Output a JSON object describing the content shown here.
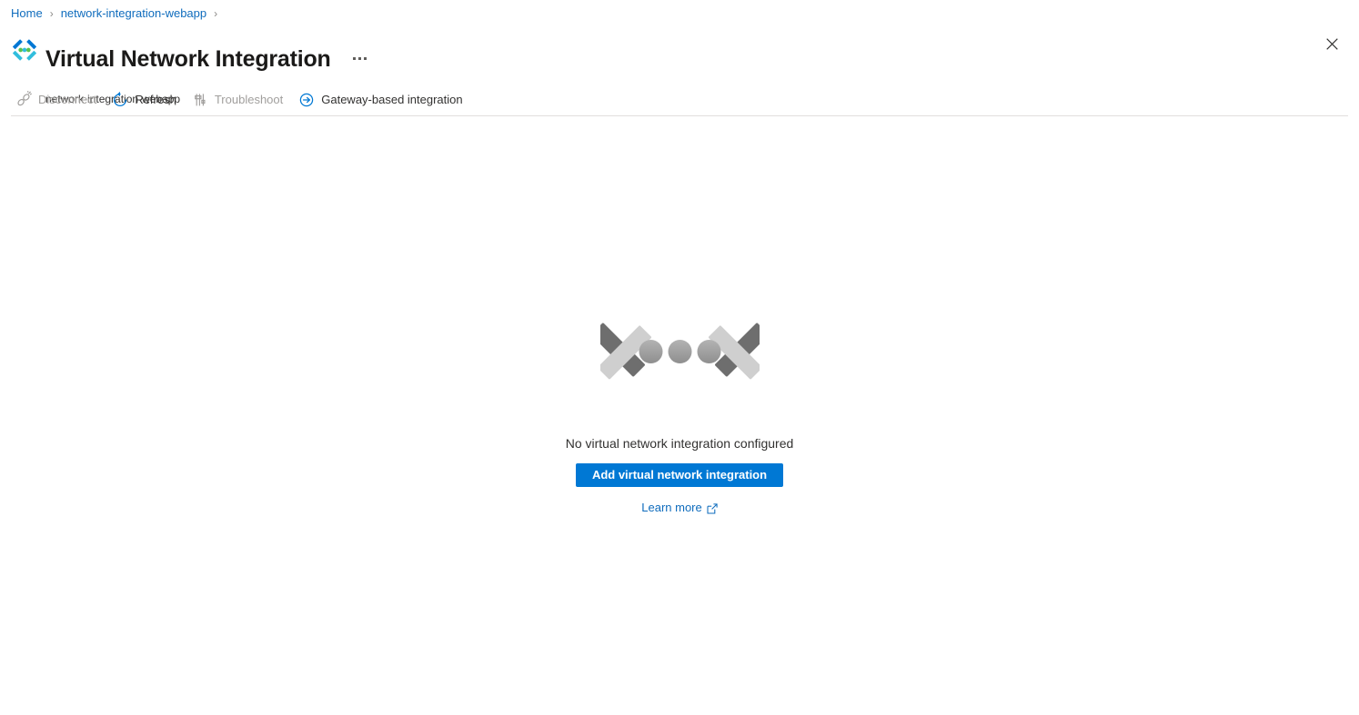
{
  "breadcrumb": {
    "items": [
      {
        "label": "Home",
        "icon": "none"
      },
      {
        "label": "network-integration-webapp",
        "icon": "none"
      }
    ],
    "separator": "›"
  },
  "header": {
    "icon": "virtual-network-integration-icon",
    "title": "Virtual Network Integration",
    "subtitle": "network-integration-webapp",
    "more_menu_label": "…",
    "close_label": "✕"
  },
  "toolbar": {
    "commands": [
      {
        "label": "Disconnect",
        "icon": "disconnect-icon",
        "enabled": false
      },
      {
        "label": "Refresh",
        "icon": "refresh-icon",
        "enabled": true
      },
      {
        "label": "Troubleshoot",
        "icon": "troubleshoot-icon",
        "enabled": false
      },
      {
        "label": "Gateway-based integration",
        "icon": "arrow-circle-right-icon",
        "enabled": true
      }
    ]
  },
  "empty_state": {
    "graphic": "virtual-network-integration-grey-icon",
    "message": "No virtual network integration configured",
    "primary_button": "Add virtual network integration",
    "learn_more": "Learn more",
    "learn_more_icon": "external-link-icon"
  },
  "colors": {
    "accent": "#0078d4",
    "link": "#0f6cbd",
    "disabled_text": "#a19f9d",
    "text": "#323130",
    "title_text": "#1b1a19",
    "divider": "#e1dfdd",
    "graphic_dark": "#6e6e6e",
    "graphic_light": "#cfcfcf",
    "icon_blue": "#0078d4",
    "icon_cyan": "#32bedd",
    "icon_green": "#5ac34e"
  }
}
